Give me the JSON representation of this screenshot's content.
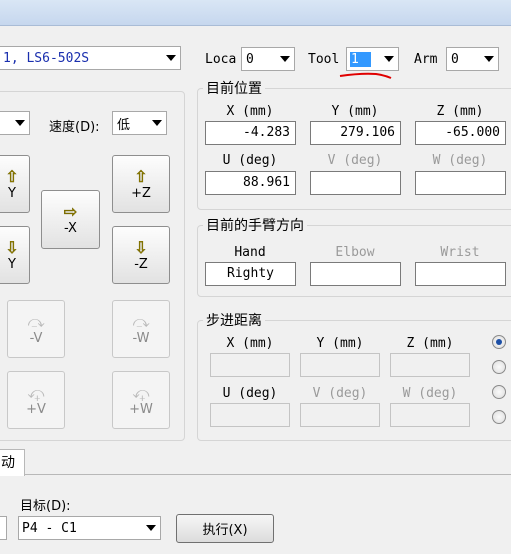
{
  "toolbar": {
    "robot_value": "1, LS6-502S",
    "loca_label": "Loca",
    "loca_value": "0",
    "tool_label": "Tool",
    "tool_value": "1",
    "arm_label": "Arm",
    "arm_value": "0"
  },
  "jog_panel": {
    "mode_value": "",
    "speed_label": "速度(D):",
    "speed_value": "低",
    "buttons": {
      "plus_y": "Y",
      "minus_y": "Y",
      "minus_x": "-X",
      "plus_z": "+Z",
      "minus_z": "-Z",
      "minus_v": "-V",
      "minus_w": "-W",
      "plus_v": "+V",
      "plus_w": "+W"
    }
  },
  "current_position": {
    "title": "目前位置",
    "x_label": "X (mm)",
    "y_label": "Y (mm)",
    "z_label": "Z (mm)",
    "u_label": "U (deg)",
    "v_label": "V (deg)",
    "w_label": "W (deg)",
    "x_value": "-4.283",
    "y_value": "279.106",
    "z_value": "-65.000",
    "u_value": "88.961",
    "v_value": "",
    "w_value": ""
  },
  "arm_orientation": {
    "title": "目前的手臂方向",
    "hand_label": "Hand",
    "elbow_label": "Elbow",
    "wrist_label": "Wrist",
    "hand_value": "Righty",
    "elbow_value": "",
    "wrist_value": ""
  },
  "step_distance": {
    "title": "步进距离",
    "x_label": "X (mm)",
    "y_label": "Y (mm)",
    "z_label": "Z (mm)",
    "u_label": "U (deg)",
    "v_label": "V (deg)",
    "w_label": "W (deg)",
    "selected_option": 1
  },
  "bottom": {
    "tab_label": "动",
    "target_label": "目标(D):",
    "target_value": "P4 - C1",
    "execute_label": "执行(X)",
    "left_field_value": ""
  },
  "colors": {
    "accent": "#3399ff",
    "annotation": "#e00000",
    "jog_arrow": "#ffe800"
  }
}
